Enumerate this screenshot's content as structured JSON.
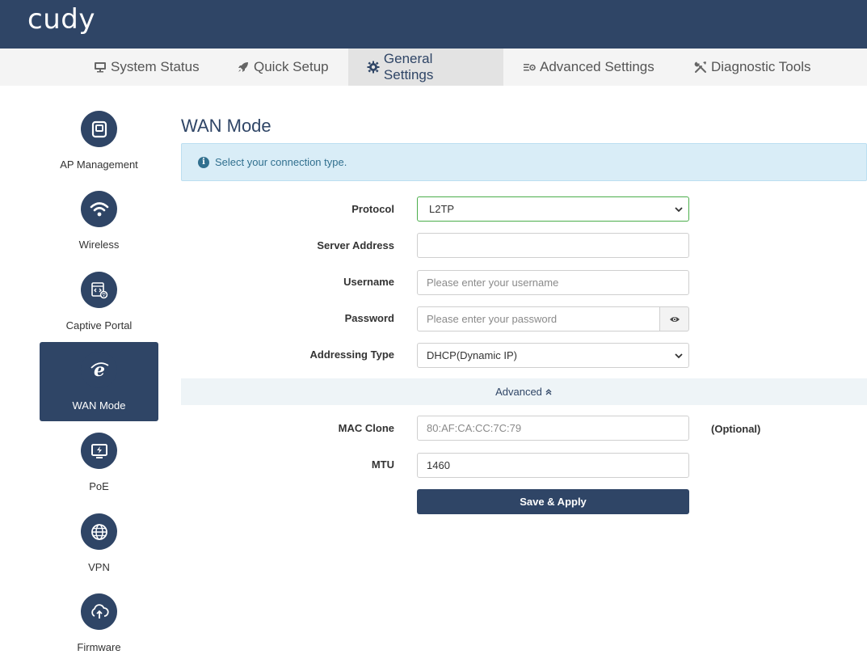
{
  "brand": {
    "logo_text": "cudy"
  },
  "nav": {
    "items": [
      {
        "label": "System Status",
        "icon": "monitor-icon"
      },
      {
        "label": "Quick Setup",
        "icon": "rocket-icon"
      },
      {
        "label": "General Settings",
        "icon": "gear-icon",
        "active": true
      },
      {
        "label": "Advanced Settings",
        "icon": "sliders-gear-icon"
      },
      {
        "label": "Diagnostic Tools",
        "icon": "wrench-screwdriver-icon"
      }
    ]
  },
  "sidebar": {
    "items": [
      {
        "label": "AP Management",
        "icon": "ap-device-icon"
      },
      {
        "label": "Wireless",
        "icon": "wifi-icon"
      },
      {
        "label": "Captive Portal",
        "icon": "portal-page-icon"
      },
      {
        "label": "WAN Mode",
        "icon": "internet-e-icon",
        "active": true
      },
      {
        "label": "PoE",
        "icon": "poe-monitor-icon"
      },
      {
        "label": "VPN",
        "icon": "globe-icon"
      },
      {
        "label": "Firmware",
        "icon": "cloud-upload-icon"
      }
    ]
  },
  "page": {
    "title": "WAN Mode",
    "info_text": "Select your connection type."
  },
  "form": {
    "protocol": {
      "label": "Protocol",
      "value": "L2TP"
    },
    "server_address": {
      "label": "Server Address",
      "value": ""
    },
    "username": {
      "label": "Username",
      "placeholder": "Please enter your username"
    },
    "password": {
      "label": "Password",
      "placeholder": "Please enter your password"
    },
    "addressing_type": {
      "label": "Addressing Type",
      "value": "DHCP(Dynamic IP)"
    },
    "advanced_label": "Advanced",
    "mac_clone": {
      "label": "MAC Clone",
      "placeholder": "80:AF:CA:CC:7C:79",
      "hint": "(Optional)"
    },
    "mtu": {
      "label": "MTU",
      "value": "1460"
    },
    "save_label": "Save & Apply"
  },
  "colors": {
    "primary": "#2f4566",
    "info_bg": "#d9edf7",
    "info_text": "#31708f",
    "focus_border": "#4cae4c"
  }
}
